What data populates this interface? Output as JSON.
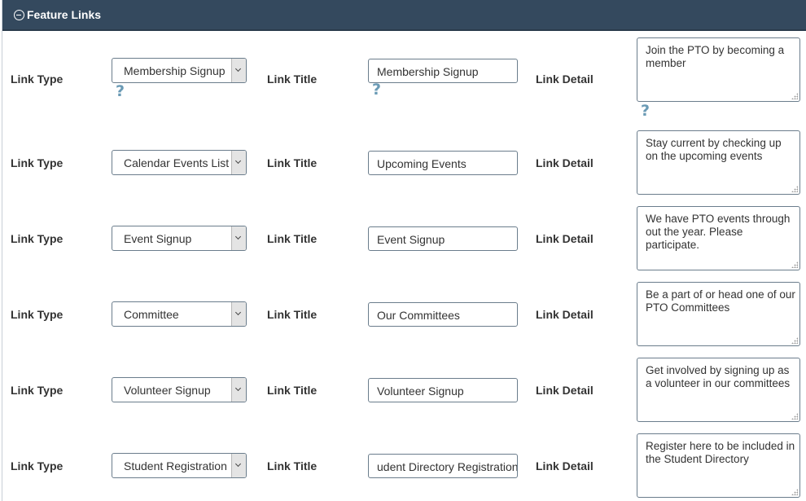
{
  "panel": {
    "title": "Feature Links",
    "help_glyph": "?"
  },
  "labels": {
    "link_type": "Link Type",
    "link_title": "Link Title",
    "link_detail": "Link Detail"
  },
  "rows": [
    {
      "link_type": "Membership Signup",
      "link_title": "Membership Signup",
      "link_detail": "Join the PTO by becoming a member"
    },
    {
      "link_type": "Calendar Events List",
      "link_title": "Upcoming Events",
      "link_detail": "Stay current by checking up on the upcoming events"
    },
    {
      "link_type": "Event Signup",
      "link_title": "Event Signup",
      "link_detail": "We have PTO events through out the year. Please participate."
    },
    {
      "link_type": "Committee",
      "link_title": "Our Committees",
      "link_detail": "Be a part of or head one of our PTO Committees"
    },
    {
      "link_type": "Volunteer Signup",
      "link_title": "Volunteer Signup",
      "link_detail": "Get involved by signing up as a volunteer in our committees"
    },
    {
      "link_type": "Student Registration",
      "link_title": "udent Directory Registration",
      "link_detail": "Register here to be included in the Student Directory"
    }
  ],
  "icons": {
    "collapse": "minus-circle-icon",
    "help": "question-mark-icon",
    "dropdown": "chevron-down-icon",
    "resize": "resize-grip-icon"
  },
  "colors": {
    "header_bg": "#34495e",
    "help_icon": "#6a9ab5"
  }
}
